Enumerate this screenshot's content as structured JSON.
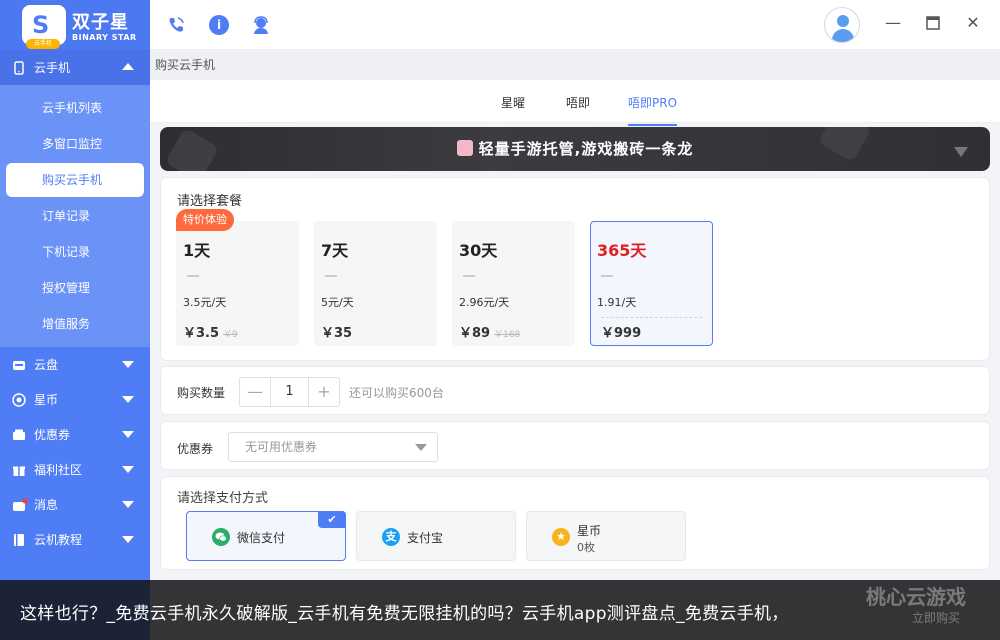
{
  "app": {
    "logo_cn": "双子星",
    "logo_en": "BINARY STAR",
    "logo_badge": "云手机"
  },
  "sidebar": {
    "groups": [
      {
        "label": "云手机",
        "icon": "phone-icon",
        "open": true,
        "items": [
          {
            "label": "云手机列表",
            "active": false
          },
          {
            "label": "多窗口监控",
            "active": false
          },
          {
            "label": "购买云手机",
            "active": true
          },
          {
            "label": "订单记录",
            "active": false
          },
          {
            "label": "下机记录",
            "active": false
          },
          {
            "label": "授权管理",
            "active": false
          },
          {
            "label": "增值服务",
            "active": false
          }
        ]
      },
      {
        "label": "云盘",
        "icon": "cloud-disk-icon"
      },
      {
        "label": "星币",
        "icon": "star-coin-icon"
      },
      {
        "label": "优惠券",
        "icon": "coupon-icon"
      },
      {
        "label": "福利社区",
        "icon": "gift-icon"
      },
      {
        "label": "消息",
        "icon": "message-icon"
      },
      {
        "label": "云机教程",
        "icon": "tutorial-icon"
      }
    ]
  },
  "topbar": {
    "icons": [
      "phone-call-icon",
      "info-icon",
      "support-icon"
    ],
    "window_controls": [
      "minimize-icon",
      "maximize-icon",
      "close-icon"
    ]
  },
  "breadcrumb": "购买云手机",
  "tabs": [
    {
      "label": "星曜",
      "active": false
    },
    {
      "label": "唔即",
      "active": false
    },
    {
      "label": "唔即PRO",
      "active": true
    }
  ],
  "banner": {
    "text": "轻量手游托管,游戏搬砖一条龙"
  },
  "packages": {
    "title": "请选择套餐",
    "hot_tag": "特价体验",
    "items": [
      {
        "days": "1天",
        "unit_price": "3.5元/天",
        "price": "￥3.5",
        "original": "￥9",
        "selected": false
      },
      {
        "days": "7天",
        "unit_price": "5元/天",
        "price": "￥35",
        "original": "",
        "selected": false
      },
      {
        "days": "30天",
        "unit_price": "2.96元/天",
        "price": "￥89",
        "original": "￥168",
        "selected": false
      },
      {
        "days": "365天",
        "unit_price": "1.91/天",
        "price": "￥999",
        "original": "",
        "selected": true
      }
    ]
  },
  "quantity": {
    "label": "购买数量",
    "minus": "—",
    "value": "1",
    "plus": "+",
    "hint": "还可以购买600台"
  },
  "coupon": {
    "label": "优惠券",
    "placeholder": "无可用优惠券"
  },
  "payment": {
    "title": "请选择支付方式",
    "options": [
      {
        "name": "微信支付",
        "sub": "",
        "icon": "wechat-icon",
        "color": "#2aae67",
        "selected": true
      },
      {
        "name": "支付宝",
        "sub": "",
        "icon": "alipay-icon",
        "color": "#1aa0f0",
        "selected": false
      },
      {
        "name": "星币",
        "sub": "0枚",
        "icon": "star-coin-icon",
        "color": "#f5b31c",
        "selected": false
      }
    ],
    "check_mark": "✔"
  },
  "overlay": {
    "caption": "这样也行？_免费云手机永久破解版_云手机有免费无限挂机的吗？云手机app测评盘点_免费云手机，",
    "watermark": "桃心云游戏",
    "watermark_sub": "立即购买"
  },
  "colors": {
    "accent": "#4f7df5",
    "highlight_price": "#e02020",
    "hot_tag": "#ff6a3c"
  }
}
